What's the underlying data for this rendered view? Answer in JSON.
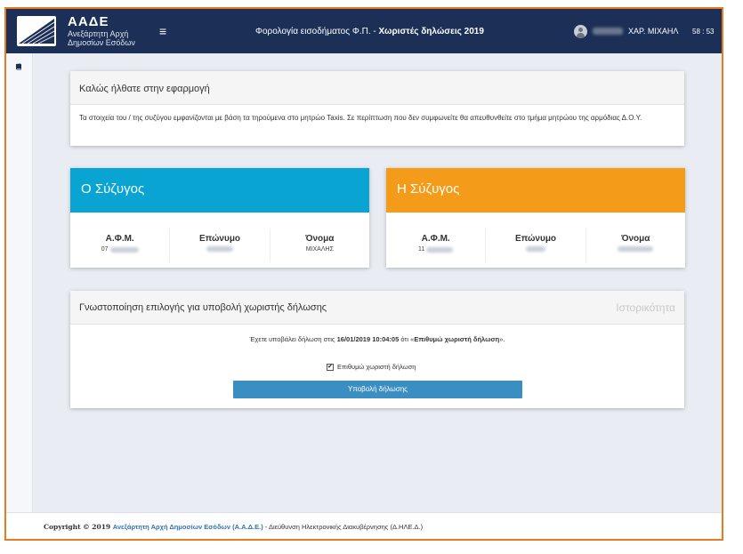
{
  "header": {
    "brand_title": "ΑΑΔΕ",
    "brand_sub1": "Ανεξάρτητη Αρχή",
    "brand_sub2": "Δημοσίων Εσόδων",
    "menu_icon": "≡",
    "app_title_prefix": "Φορολογία εισοδήματος Φ.Π. - ",
    "app_title_bold": "Χωριστές δηλώσεις 2019",
    "user_name": "ΧΑΡ. ΜΙΧΑΗΛ",
    "timer": "58 : 53"
  },
  "welcome": {
    "title": "Καλώς ήλθατε στην εφαρμογή",
    "text": "Τα στοιχεία του / της συζύγου εμφανίζονται με βάση τα τηρούμενα στο μητρώο Taxis. Σε περίπτωση που δεν συμφωνείτε θα απευθυνθείτε στο τμήμα μητρώου της αρμόδιας Δ.Ο.Υ."
  },
  "husband": {
    "title": "Ο Σύζυγος",
    "afm_label": "Α.Φ.Μ.",
    "afm_prefix": "07",
    "surname_label": "Επώνυμο",
    "name_label": "Όνομα",
    "name_value": "ΜΙΧΑΛΗΣ"
  },
  "wife": {
    "title": "Η Σύζυγος",
    "afm_label": "Α.Φ.Μ.",
    "afm_prefix": "11",
    "surname_label": "Επώνυμο",
    "name_label": "Όνομα"
  },
  "notification": {
    "title": "Γνωστοποίηση επιλογής για υποβολή χωριστής δήλωσης",
    "history_link": "Ιστορικότητα",
    "msg_prefix": "Έχετε υποβάλει δήλωση στις ",
    "msg_date": "16/01/2019 10:04:05",
    "msg_middle": " ότι «",
    "msg_choice": "Επιθυμώ χωριστή δήλωση",
    "msg_suffix": "».",
    "checkbox_label": "Επιθυμώ χωριστή δήλωση",
    "checkbox_checked": true,
    "submit_label": "Υποβολή δήλωσης"
  },
  "footer": {
    "copyright": "Copyright © 2019 ",
    "org": "Ανεξάρτητη Αρχή Δημοσίων Εσόδων (Α.Α.Δ.Ε.)",
    "rest": " - Διεύθυνση Ηλεκτρονικής Διακυβέρνησης (Δ.ΗΛΕ.Δ.)"
  },
  "icons": {
    "logo": "aade-logo-icon",
    "menu": "hamburger-menu-icon",
    "avatar": "user-avatar-icon",
    "sidebar": "book-icon",
    "checkbox_check": "✔"
  },
  "colors": {
    "topbar": "#1c3057",
    "husband_header": "#0aa4d3",
    "wife_header": "#f49b1a",
    "submit_button": "#3b8ec2",
    "frame_border": "#e87a22"
  }
}
